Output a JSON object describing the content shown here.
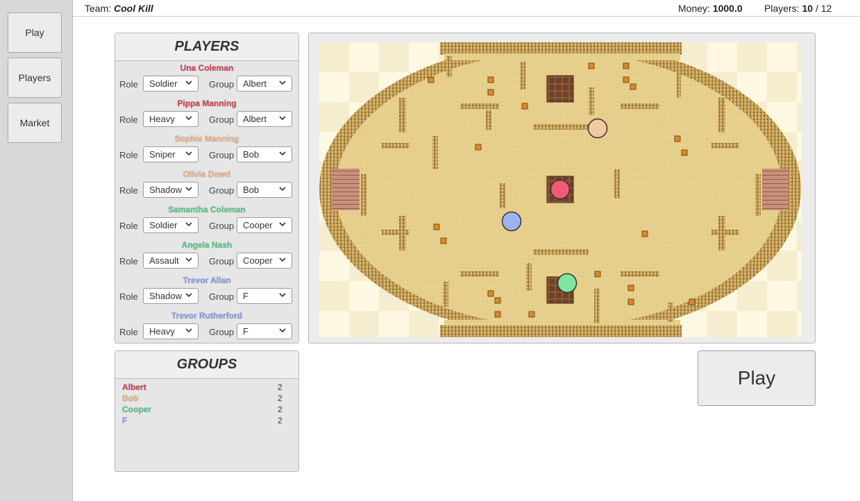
{
  "nav": {
    "play": "Play",
    "players": "Players",
    "market": "Market"
  },
  "topbar": {
    "team_label": "Team:",
    "team_name": "Cool Kill",
    "money_label": "Money:",
    "money_value": "1000.0",
    "players_label": "Players:",
    "players_current": "10",
    "players_sep": "/ 12"
  },
  "players_panel": {
    "title": "PLAYERS",
    "role_label": "Role",
    "group_label": "Group",
    "items": [
      {
        "name": "Una Coleman",
        "color": "#d6405a",
        "role": "Soldier",
        "group": "Albert"
      },
      {
        "name": "Pippa Manning",
        "color": "#d6405a",
        "role": "Heavy",
        "group": "Albert"
      },
      {
        "name": "Sophie Manning",
        "color": "#e8b48c",
        "role": "Sniper",
        "group": "Bob"
      },
      {
        "name": "Olivia Dowd",
        "color": "#e8b48c",
        "role": "Shadow",
        "group": "Bob"
      },
      {
        "name": "Samantha Coleman",
        "color": "#5cc88a",
        "role": "Soldier",
        "group": "Cooper"
      },
      {
        "name": "Angela Nash",
        "color": "#5cc88a",
        "role": "Assault",
        "group": "Cooper"
      },
      {
        "name": "Trevor Allan",
        "color": "#8a9ee8",
        "role": "Shadow",
        "group": "F"
      },
      {
        "name": "Trevor Rutherford",
        "color": "#8a9ee8",
        "role": "Heavy",
        "group": "F"
      }
    ]
  },
  "groups_panel": {
    "title": "GROUPS",
    "items": [
      {
        "name": "Albert",
        "count": "2",
        "color": "#d6405a"
      },
      {
        "name": "Bob",
        "count": "2",
        "color": "#e8b48c"
      },
      {
        "name": "Cooper",
        "count": "2",
        "color": "#5cc88a"
      },
      {
        "name": "F",
        "count": "2",
        "color": "#8a9ee8"
      }
    ]
  },
  "map": {
    "markers": [
      {
        "group": "Albert",
        "color": "#f25a78"
      },
      {
        "group": "Bob",
        "color": "#f3c9a0"
      },
      {
        "group": "Cooper",
        "color": "#7fe6a2"
      },
      {
        "group": "F",
        "color": "#9fb2f0"
      }
    ]
  },
  "play_button": "Play"
}
